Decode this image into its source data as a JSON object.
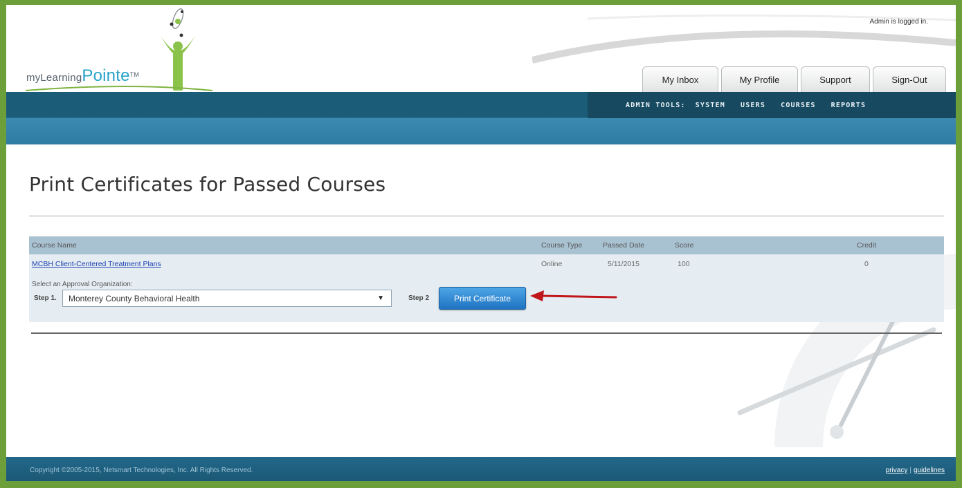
{
  "header": {
    "logo": {
      "prefix": "myLearning",
      "accent": "Pointe",
      "tm": "TM"
    },
    "login_status": "Admin is logged in.",
    "tabs": [
      "My Inbox",
      "My Profile",
      "Support",
      "Sign-Out"
    ]
  },
  "admin_nav": {
    "label": "ADMIN TOOLS:",
    "links": [
      "SYSTEM",
      "USERS",
      "COURSES",
      "REPORTS"
    ]
  },
  "page": {
    "title": "Print Certificates for Passed Courses"
  },
  "table": {
    "columns": [
      "Course Name",
      "Course Type",
      "Passed Date",
      "Score",
      "Credit"
    ],
    "rows": [
      {
        "course_name": "MCBH Client-Centered Treatment Plans",
        "course_type": "Online",
        "passed_date": "5/11/2015",
        "score": "100",
        "credit": "0"
      }
    ],
    "approval_label": "Select an Approval Organization:",
    "step1_label": "Step 1.",
    "selected_org": "Monterey County Behavioral Health",
    "step2_label": "Step 2",
    "print_button": "Print Certificate"
  },
  "footer": {
    "copyright": "Copyright ©2005-2015, Netsmart Technologies, Inc. All Rights Reserved.",
    "privacy": "privacy",
    "separator": "|",
    "guidelines": "guidelines"
  },
  "colors": {
    "frame_green": "#6c9e3a",
    "nav_dark": "#1b5d78",
    "nav_accent": "#2e7ba3",
    "button_blue": "#1f73c1",
    "arrow_red": "#c0161b",
    "header_cell": "#a9c2d2"
  }
}
